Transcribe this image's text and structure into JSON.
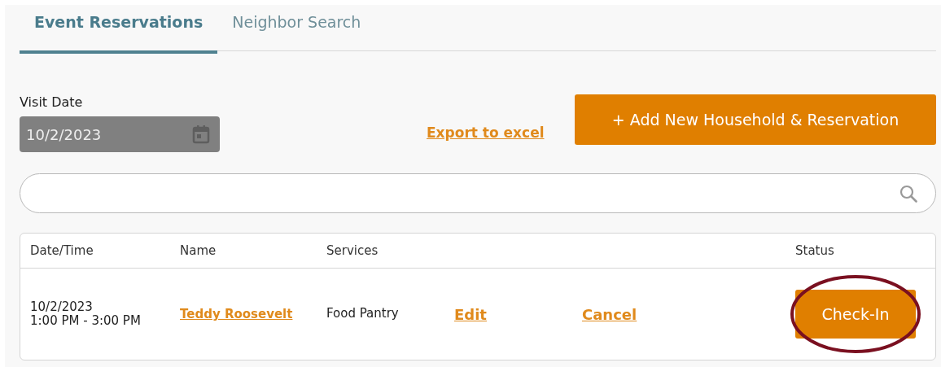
{
  "tabs": [
    {
      "label": "Event Reservations",
      "selected": true
    },
    {
      "label": "Neighbor Search",
      "selected": false
    }
  ],
  "visit_date": {
    "label": "Visit Date",
    "value": "10/2/2023"
  },
  "export_link": "Export to excel",
  "add_button": "+ Add New Household & Reservation",
  "table": {
    "columns": [
      "Date/Time",
      "Name",
      "Services",
      "Status"
    ],
    "rows": [
      {
        "date": "10/2/2023",
        "time": "1:00 PM - 3:00 PM",
        "name": "Teddy Roosevelt",
        "services": "Food Pantry",
        "edit": "Edit",
        "cancel": "Cancel",
        "status_button": "Check-In",
        "circled": true
      }
    ]
  }
}
